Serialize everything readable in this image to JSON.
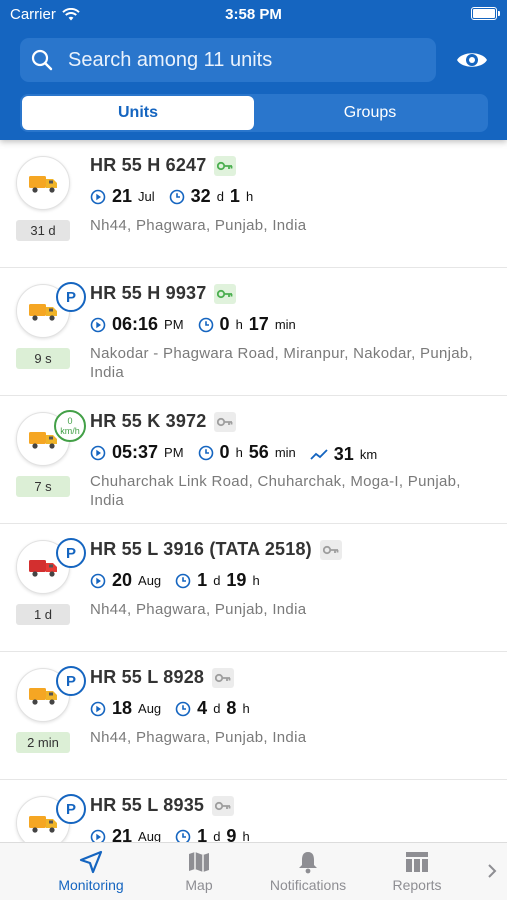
{
  "status_bar": {
    "carrier": "Carrier",
    "time": "3:58 PM"
  },
  "search": {
    "placeholder": "Search among 11 units",
    "value": ""
  },
  "segments": [
    {
      "label": "Units",
      "active": true
    },
    {
      "label": "Groups",
      "active": false
    }
  ],
  "colors": {
    "accent": "#1565c0",
    "green": "#43a047",
    "gray_text": "#7a7a7a"
  },
  "units": [
    {
      "name": "HR 55 H 6247",
      "key": "green",
      "badge": "",
      "ago": "31 d",
      "ago_style": "gray",
      "truck": "yellow",
      "time_main": "21",
      "time_sub": "Jul",
      "dur_main1": "32",
      "dur_sub1": "d",
      "dur_main2": "1",
      "dur_sub2": "h",
      "dist": "",
      "dist_unit": "",
      "address": "Nh44, Phagwara, Punjab, India"
    },
    {
      "name": "HR 55 H 9937",
      "key": "green",
      "badge": "P",
      "ago": "9 s",
      "ago_style": "green",
      "truck": "yellow",
      "time_main": "06:16",
      "time_sub": "PM",
      "dur_main1": "0",
      "dur_sub1": "h",
      "dur_main2": "17",
      "dur_sub2": "min",
      "dist": "",
      "dist_unit": "",
      "address": "Nakodar - Phagwara Road, Miranpur, Nakodar, Punjab, India"
    },
    {
      "name": "HR 55 K 3972",
      "key": "gray",
      "badge": "speed",
      "speed_value": "0",
      "speed_unit": "km/h",
      "ago": "7 s",
      "ago_style": "green",
      "truck": "yellow",
      "time_main": "05:37",
      "time_sub": "PM",
      "dur_main1": "0",
      "dur_sub1": "h",
      "dur_main2": "56",
      "dur_sub2": "min",
      "dist": "31",
      "dist_unit": "km",
      "address": "Chuharchak Link Road, Chuharchak, Moga-I, Punjab, India"
    },
    {
      "name": "HR 55 L 3916 (TATA 2518)",
      "key": "gray",
      "badge": "P",
      "ago": "1 d",
      "ago_style": "gray",
      "truck": "red",
      "time_main": "20",
      "time_sub": "Aug",
      "dur_main1": "1",
      "dur_sub1": "d",
      "dur_main2": "19",
      "dur_sub2": "h",
      "dist": "",
      "dist_unit": "",
      "address": "Nh44, Phagwara, Punjab, India"
    },
    {
      "name": "HR 55 L 8928",
      "key": "gray",
      "badge": "P",
      "ago": "2 min",
      "ago_style": "green",
      "truck": "yellow",
      "time_main": "18",
      "time_sub": "Aug",
      "dur_main1": "4",
      "dur_sub1": "d",
      "dur_main2": "8",
      "dur_sub2": "h",
      "dist": "",
      "dist_unit": "",
      "address": "Nh44, Phagwara, Punjab, India"
    },
    {
      "name": "HR 55 L 8935",
      "key": "gray",
      "badge": "P",
      "ago": "",
      "ago_style": "gray",
      "truck": "yellow",
      "time_main": "21",
      "time_sub": "Aug",
      "dur_main1": "1",
      "dur_sub1": "d",
      "dur_main2": "9",
      "dur_sub2": "h",
      "dist": "",
      "dist_unit": "",
      "address": ""
    }
  ],
  "tabs": [
    {
      "label": "Monitoring",
      "icon": "navigation-arrow-icon",
      "active": true
    },
    {
      "label": "Map",
      "icon": "map-icon",
      "active": false
    },
    {
      "label": "Notifications",
      "icon": "bell-icon",
      "active": false
    },
    {
      "label": "Reports",
      "icon": "reports-icon",
      "active": false
    }
  ]
}
